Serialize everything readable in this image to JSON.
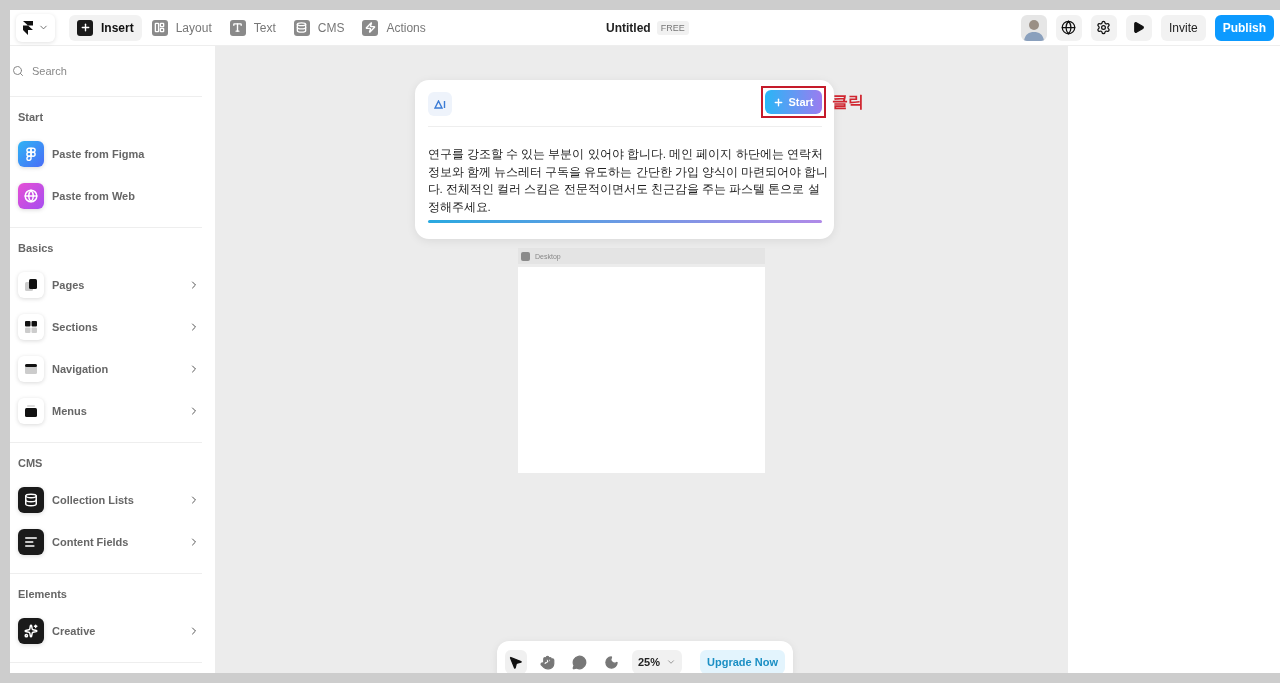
{
  "topbar": {
    "menu_tabs": [
      {
        "label": "Insert",
        "selected": true
      },
      {
        "label": "Layout",
        "selected": false
      },
      {
        "label": "Text",
        "selected": false
      },
      {
        "label": "CMS",
        "selected": false
      },
      {
        "label": "Actions",
        "selected": false
      }
    ],
    "title": "Untitled",
    "plan_badge": "FREE",
    "invite": "Invite",
    "publish": "Publish"
  },
  "sidebar": {
    "search": {
      "placeholder": "Search"
    },
    "sections": [
      {
        "title": "Start",
        "items": [
          {
            "label": "Paste from Figma",
            "expandable": false
          },
          {
            "label": "Paste from Web",
            "expandable": false
          }
        ]
      },
      {
        "title": "Basics",
        "items": [
          {
            "label": "Pages",
            "expandable": true
          },
          {
            "label": "Sections",
            "expandable": true
          },
          {
            "label": "Navigation",
            "expandable": true
          },
          {
            "label": "Menus",
            "expandable": true
          }
        ]
      },
      {
        "title": "CMS",
        "items": [
          {
            "label": "Collection Lists",
            "expandable": true
          },
          {
            "label": "Content Fields",
            "expandable": true
          }
        ]
      },
      {
        "title": "Elements",
        "items": [
          {
            "label": "Creative",
            "expandable": true
          }
        ]
      }
    ]
  },
  "prompt": {
    "start": "Start",
    "annotation": "클릭",
    "lines": [
      "연구를 강조할 수 있는 부분이 있어야 합니다. 메인 페이지 하단에는 연락처",
      "정보와 함께 뉴스레터 구독을 유도하는 간단한 가입 양식이 마련되어야 합니",
      "다. 전체적인 컬러 스킴은 전문적이면서도 친근감을 주는 파스텔 톤으로 설",
      "정해주세요."
    ]
  },
  "frame": {
    "label": "Desktop"
  },
  "toolbar": {
    "tools": [
      {
        "selected": true
      },
      {
        "selected": false
      },
      {
        "selected": false
      },
      {
        "selected": false
      }
    ],
    "zoom": "25%",
    "upgrade": "Upgrade Now"
  }
}
